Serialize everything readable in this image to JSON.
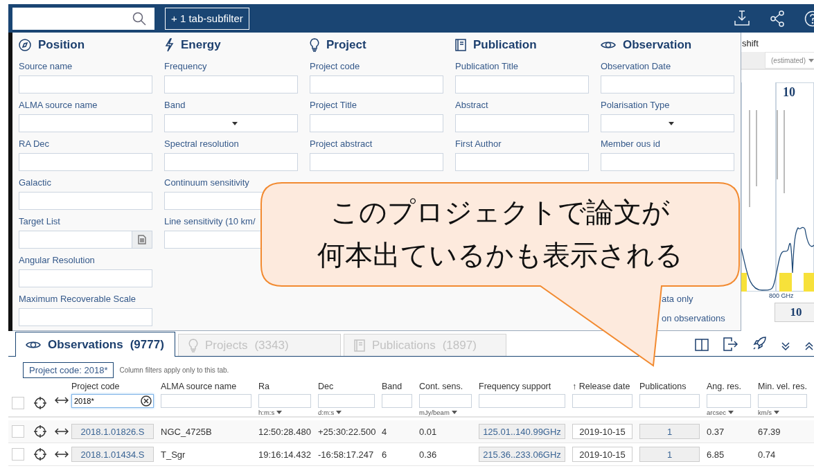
{
  "toolbar": {
    "subfilter_button": "+ 1 tab-subfilter"
  },
  "filter_panel": {
    "sections": [
      {
        "title": "Position",
        "fields": [
          {
            "label": "Source name",
            "kind": "text"
          },
          {
            "label": "ALMA source name",
            "kind": "text"
          },
          {
            "label": "RA Dec",
            "kind": "text"
          },
          {
            "label": "Galactic",
            "kind": "text"
          },
          {
            "label": "Target List",
            "kind": "file"
          },
          {
            "label": "Angular Resolution",
            "kind": "text"
          },
          {
            "label": "Maximum Recoverable Scale",
            "kind": "text"
          }
        ]
      },
      {
        "title": "Energy",
        "fields": [
          {
            "label": "Frequency",
            "kind": "text"
          },
          {
            "label": "Band",
            "kind": "select"
          },
          {
            "label": "Spectral resolution",
            "kind": "text"
          },
          {
            "label": "Continuum sensitivity",
            "kind": "text"
          },
          {
            "label": "Line sensitivity (10 km/",
            "kind": "text"
          }
        ]
      },
      {
        "title": "Project",
        "fields": [
          {
            "label": "Project code",
            "kind": "text"
          },
          {
            "label": "Project Title",
            "kind": "text"
          },
          {
            "label": "Project abstract",
            "kind": "text"
          }
        ]
      },
      {
        "title": "Publication",
        "fields": [
          {
            "label": "Publication Title",
            "kind": "text"
          },
          {
            "label": "Abstract",
            "kind": "text"
          },
          {
            "label": "First Author",
            "kind": "text"
          }
        ]
      },
      {
        "title": "Observation",
        "fields": [
          {
            "label": "Observation Date",
            "kind": "text"
          },
          {
            "label": "Polarisation Type",
            "kind": "select"
          },
          {
            "label": "Member ous id",
            "kind": "text"
          }
        ],
        "options": [
          "ata only",
          "on observations"
        ]
      }
    ]
  },
  "spectrum": {
    "heading": "shift",
    "redshift_select": "(estimated)",
    "band_label": "10",
    "axis_label": "800 GHz",
    "zoom_value": "10"
  },
  "tabs": [
    {
      "label": "Observations",
      "count": "(9777)",
      "selected": true
    },
    {
      "label": "Projects",
      "count": "(3343)",
      "selected": false
    },
    {
      "label": "Publications",
      "count": "(1897)",
      "selected": false
    }
  ],
  "active_filter": {
    "chip": "Project code: 2018*",
    "note": "Column filters apply only to this tab."
  },
  "table": {
    "select_all_checked": false,
    "columns": [
      {
        "label": "Project code",
        "kind": "link",
        "filter": "2018*"
      },
      {
        "label": "ALMA source name",
        "kind": "plain"
      },
      {
        "label": "Ra",
        "kind": "plain",
        "unit": "h:m:s"
      },
      {
        "label": "Dec",
        "kind": "plain",
        "unit": "d:m:s"
      },
      {
        "label": "Band",
        "kind": "plain"
      },
      {
        "label": "Cont. sens.",
        "kind": "plain",
        "unit": "mJy/beam"
      },
      {
        "label": "Frequency support",
        "kind": "link"
      },
      {
        "label": "↑ Release date",
        "kind": "boxed"
      },
      {
        "label": "Publications",
        "kind": "link"
      },
      {
        "label": "Ang. res.",
        "kind": "plain",
        "unit": "arcsec"
      },
      {
        "label": "Min. vel. res.",
        "kind": "plain",
        "unit": "km/s"
      }
    ],
    "rows": [
      {
        "checked": false,
        "cells": [
          "2018.1.01826.S",
          "NGC_4725B",
          "12:50:28.480",
          "+25:30:22.500",
          "4",
          "0.01",
          "125.01..140.99GHz",
          "2019-10-15",
          "1",
          "0.37",
          "67.39"
        ]
      },
      {
        "checked": false,
        "cells": [
          "2018.1.01434.S",
          "T_Sgr",
          "19:16:14.432",
          "-16:58:17.247",
          "6",
          "0.36",
          "215.36..233.06GHz",
          "2019-10-15",
          "1",
          "6.85",
          "0.74"
        ]
      }
    ]
  },
  "callout": {
    "lines": [
      "このプロジェクトで論文が",
      "何本出ているかも表示される"
    ]
  }
}
